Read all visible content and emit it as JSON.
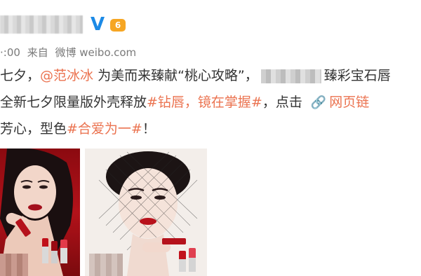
{
  "header": {
    "verified_badge": "V",
    "level_badge": "6",
    "time": "·:00",
    "source_prefix": "来自",
    "source_app": "微博 weibo.com"
  },
  "post": {
    "line1_a": "七夕，",
    "mention": "@范冰冰",
    "line1_b": " 为美而来臻献“桃心攻略”，",
    "line1_c": "臻彩宝石唇",
    "line2_a": "全新七夕限量版外壳释放",
    "hashtag1": "#钻唇，镜在掌握#",
    "line2_b": "，点击",
    "web_link": "网页链",
    "line3_a": "芳心，型色",
    "hashtag2": "#合爱为一#",
    "line3_b": "！"
  },
  "icons": {
    "verified": "verified-v-icon",
    "level": "level-badge-icon",
    "link": "paperclip-link-icon"
  },
  "colors": {
    "link": "#eb7350",
    "verified": "#1c8ae6",
    "meta": "#7a7a7a"
  }
}
